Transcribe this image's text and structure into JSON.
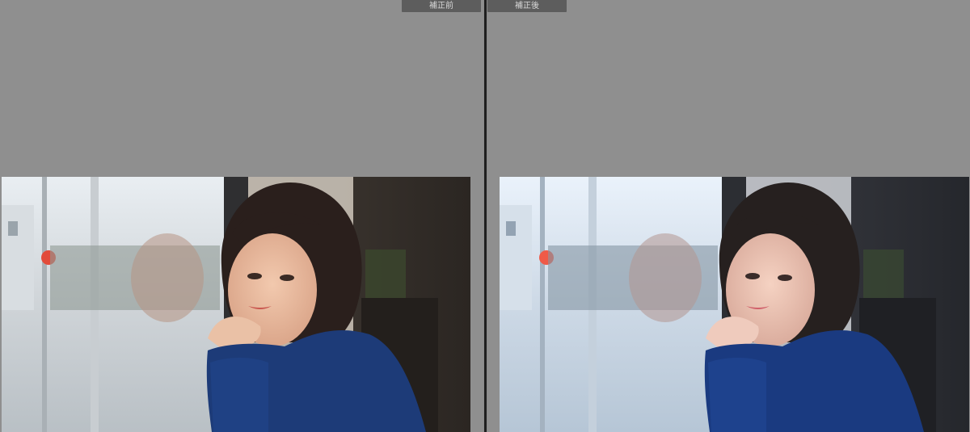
{
  "compare": {
    "before_label": "補正前",
    "after_label": "補正後"
  },
  "colors": {
    "workspace_bg": "#8e8e8e",
    "label_bg": "#5d5d5d",
    "label_text": "#d9d9d9",
    "divider": "#1f1f1f",
    "sweater": "#1d3b78",
    "hair": "#2a1f1c"
  },
  "panels": [
    {
      "id": "before",
      "tone": "warm"
    },
    {
      "id": "after",
      "tone": "cool"
    }
  ]
}
